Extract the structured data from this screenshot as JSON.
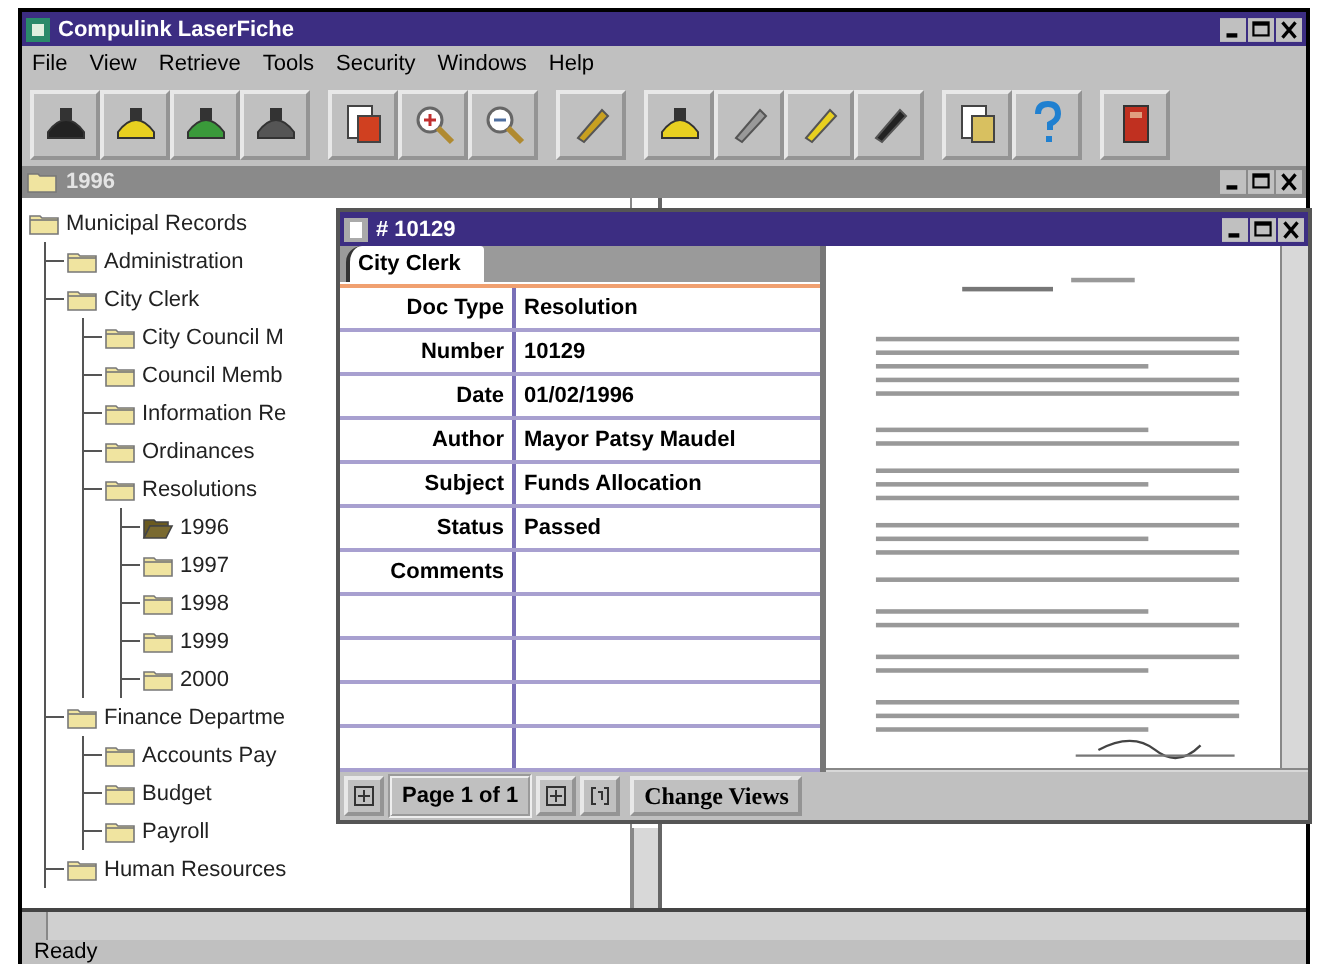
{
  "window": {
    "title": "Compulink LaserFiche"
  },
  "menu": [
    "File",
    "View",
    "Retrieve",
    "Tools",
    "Security",
    "Windows",
    "Help"
  ],
  "child_window": {
    "title": "1996"
  },
  "tree": [
    {
      "label": "Municipal Records",
      "open": false,
      "children": [
        {
          "label": "Administration",
          "open": false
        },
        {
          "label": "City Clerk",
          "open": false,
          "children": [
            {
              "label": "City Council M",
              "open": false
            },
            {
              "label": "Council Memb",
              "open": false
            },
            {
              "label": "Information Re",
              "open": false
            },
            {
              "label": "Ordinances",
              "open": false
            },
            {
              "label": "Resolutions",
              "open": false,
              "children": [
                {
                  "label": "1996",
                  "open": true
                },
                {
                  "label": "1997",
                  "open": false
                },
                {
                  "label": "1998",
                  "open": false
                },
                {
                  "label": "1999",
                  "open": false
                },
                {
                  "label": "2000",
                  "open": false
                }
              ]
            }
          ]
        },
        {
          "label": "Finance Departme",
          "open": false,
          "children": [
            {
              "label": "Accounts Pay",
              "open": false
            },
            {
              "label": "Budget",
              "open": false
            },
            {
              "label": "Payroll",
              "open": false
            }
          ]
        },
        {
          "label": "Human Resources",
          "open": false
        }
      ]
    }
  ],
  "document_window": {
    "title": "# 10129",
    "tab": "City Clerk",
    "fields": [
      {
        "label": "Doc Type",
        "value": "Resolution"
      },
      {
        "label": "Number",
        "value": "10129"
      },
      {
        "label": "Date",
        "value": "01/02/1996"
      },
      {
        "label": "Author",
        "value": "Mayor Patsy Maudel"
      },
      {
        "label": "Subject",
        "value": "Funds Allocation"
      },
      {
        "label": "Status",
        "value": "Passed"
      },
      {
        "label": "Comments"
      }
    ],
    "page_indicator": "Page 1 of 1",
    "change_views": "Change Views"
  },
  "status_bar": "Ready"
}
